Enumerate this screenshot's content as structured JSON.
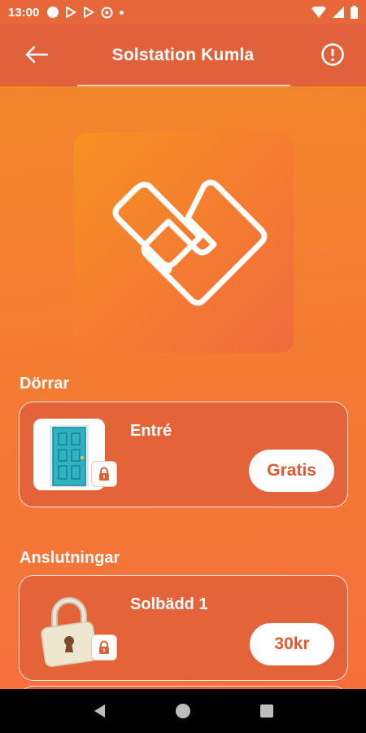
{
  "status_bar": {
    "time": "13:00"
  },
  "app_bar": {
    "title": "Solstation Kumla",
    "back_icon": "arrow-left-icon",
    "info_icon": "info-icon"
  },
  "sections": {
    "doors": {
      "title": "Dörrar",
      "items": [
        {
          "name": "Entré",
          "price": "Gratis",
          "thumb_icon": "door-icon",
          "badge_icon": "lock-icon"
        }
      ]
    },
    "connections": {
      "title": "Anslutningar",
      "items": [
        {
          "name": "Solbädd 1",
          "price": "30kr",
          "thumb_icon": "padlock-icon",
          "badge_icon": "lock-icon"
        }
      ]
    }
  },
  "colors": {
    "accent": "#e1613b",
    "price_text": "#dd5a31"
  }
}
